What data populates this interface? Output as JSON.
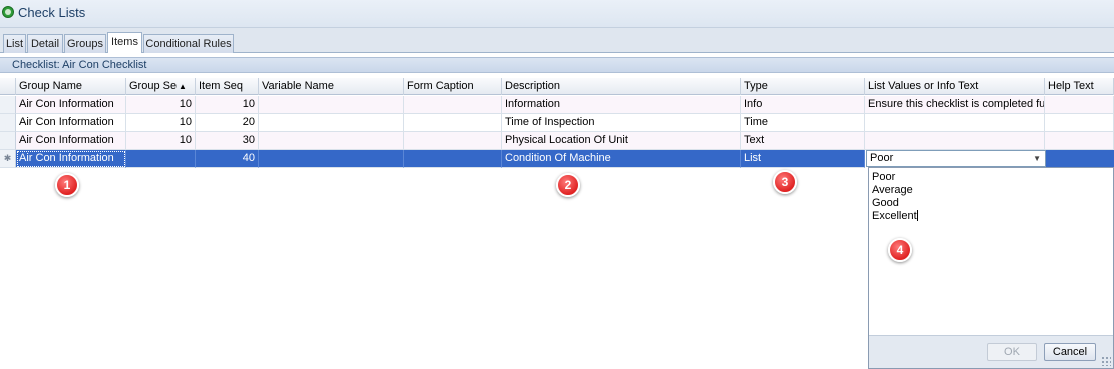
{
  "window": {
    "title": "Check Lists"
  },
  "tabs": [
    {
      "label": "List"
    },
    {
      "label": "Detail"
    },
    {
      "label": "Groups"
    },
    {
      "label": "Items"
    },
    {
      "label": "Conditional Rules"
    }
  ],
  "checklist_header": "Checklist: Air Con Checklist",
  "grid": {
    "columns": [
      "Group Name",
      "Group Seq",
      "Item Seq",
      "Variable Name",
      "Form Caption",
      "Description",
      "Type",
      "List Values or Info Text",
      "Help Text"
    ],
    "sort_indicator": "▲",
    "rows": [
      {
        "group_name": "Air Con Information",
        "group_seq": "10",
        "item_seq": "10",
        "variable_name": "",
        "form_caption": "",
        "description": "Information",
        "type": "Info",
        "list_values": "Ensure this checklist is completed fully",
        "help_text": ""
      },
      {
        "group_name": "Air Con Information",
        "group_seq": "10",
        "item_seq": "20",
        "variable_name": "",
        "form_caption": "",
        "description": "Time of Inspection",
        "type": "Time",
        "list_values": "",
        "help_text": ""
      },
      {
        "group_name": "Air Con Information",
        "group_seq": "10",
        "item_seq": "30",
        "variable_name": "",
        "form_caption": "",
        "description": "Physical Location Of Unit",
        "type": "Text",
        "list_values": "",
        "help_text": ""
      },
      {
        "group_name": "Air Con Information",
        "group_seq": "",
        "item_seq": "40",
        "variable_name": "",
        "form_caption": "",
        "description": "Condition Of Machine",
        "type": "List",
        "list_values": "Poor",
        "help_text": ""
      }
    ],
    "new_row_marker": "✱"
  },
  "popup": {
    "lines": [
      "Poor",
      "Average",
      "Good",
      "Excellent"
    ],
    "ok_label": "OK",
    "cancel_label": "Cancel"
  },
  "badges": [
    "1",
    "2",
    "3",
    "4"
  ]
}
